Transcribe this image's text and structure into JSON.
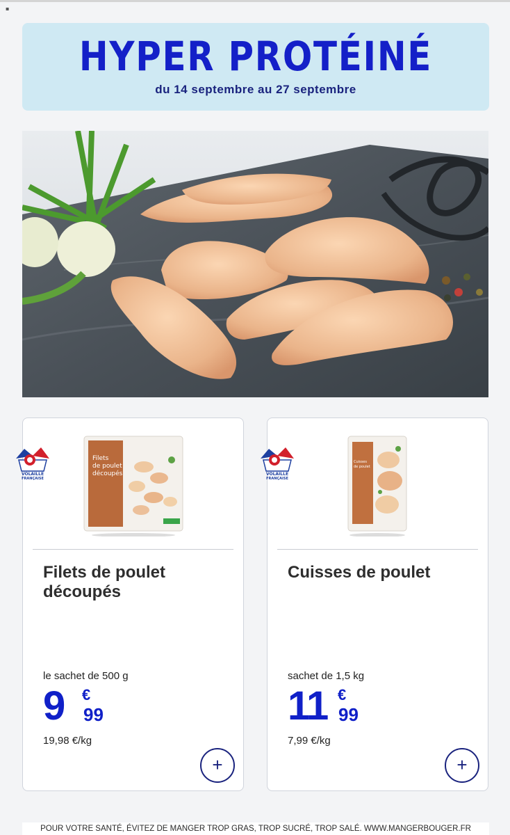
{
  "banner": {
    "title": "HYPER PROTÉINÉ",
    "dates": "du 14 septembre au 27 septembre"
  },
  "products": [
    {
      "name": "Filets de poulet découpés",
      "unit": "le sachet de 500 g",
      "price_int": "9",
      "price_currency": "€",
      "price_dec": "99",
      "per_kg": "19,98 €/kg",
      "badge_text": "VOLAILLE FRANÇAISE",
      "pack_text": "Filets de poulet découpés",
      "add_symbol": "+"
    },
    {
      "name": "Cuisses de poulet",
      "unit": "sachet de 1,5 kg",
      "price_int": "11",
      "price_currency": "€",
      "price_dec": "99",
      "per_kg": "7,99 €/kg",
      "badge_text": "VOLAILLE FRANÇAISE",
      "pack_text": "Cuisses de poulet",
      "add_symbol": "+"
    }
  ],
  "footer": {
    "text": "POUR VOTRE SANTÉ, ÉVITEZ DE MANGER TROP GRAS, TROP SUCRÉ, TROP SALÉ. WWW.MANGERBOUGER.FR"
  },
  "colors": {
    "accent": "#1420c8",
    "banner_bg": "#cfe9f3",
    "page_bg": "#f3f4f6"
  },
  "icons": [
    "volaille-francaise-badge-icon",
    "plus-icon"
  ]
}
